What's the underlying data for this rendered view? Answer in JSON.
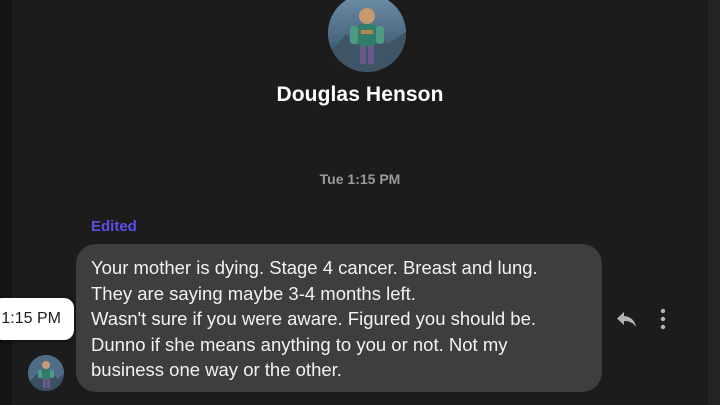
{
  "contact": {
    "name": "Douglas Henson",
    "avatar_icon": "profile-avatar"
  },
  "conversation": {
    "timestamp": "Tue 1:15 PM",
    "message": {
      "edited_label": "Edited",
      "hover_time": "1:15 PM",
      "lines": [
        "Your mother is dying. Stage 4 cancer. Breast and lung.",
        "They are saying maybe 3-4 months left.",
        "Wasn't sure if you were aware. Figured you should be.",
        "Dunno if she means anything to you or not. Not my",
        "business one way or the other."
      ]
    },
    "actions": {
      "reply_icon": "reply-icon",
      "more_icon": "more-options-icon"
    }
  },
  "colors": {
    "background": "#1c1c1c",
    "bubble": "#3e3e40",
    "edited": "#5b4fe9",
    "timestamp": "#9a9a9a",
    "name": "#ffffff"
  }
}
